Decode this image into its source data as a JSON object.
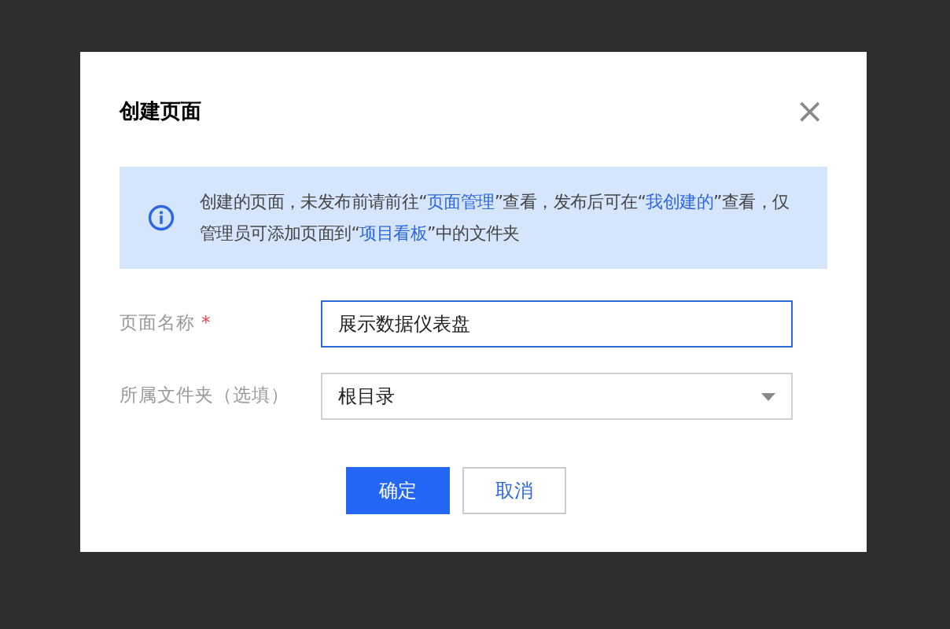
{
  "dialog": {
    "title": "创建页面",
    "close": "×"
  },
  "notice": [
    {
      "kind": "text",
      "text": "创建的页面，未发布前请前往“"
    },
    {
      "kind": "link",
      "text": "页面管理"
    },
    {
      "kind": "text",
      "text": "”查看，发布后可在“"
    },
    {
      "kind": "link",
      "text": "我创建的"
    },
    {
      "kind": "text",
      "text": "”查看，仅管理员可添加页面到“"
    },
    {
      "kind": "link",
      "text": "项目看板"
    },
    {
      "kind": "text",
      "text": "”中的文件夹"
    }
  ],
  "fields": [
    {
      "kind": "input",
      "label": "页面名称",
      "required_mark": "*",
      "value": "展示数据仪表盘",
      "focused": true
    },
    {
      "kind": "select",
      "label": "所属文件夹（选填）",
      "value": "根目录",
      "focused": false
    }
  ],
  "buttons": [
    {
      "label": "确定",
      "kind": "primary"
    },
    {
      "label": "取消",
      "kind": "secondary"
    }
  ]
}
